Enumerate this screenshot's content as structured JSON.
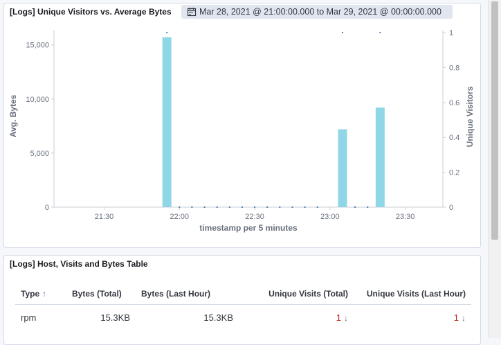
{
  "chart_panel": {
    "title": "[Logs] Unique Visitors vs. Average Bytes",
    "date_range": "Mar 28, 2021 @ 21:00:00.000 to Mar 29, 2021 @ 00:00:00.000",
    "icon": "calendar-icon"
  },
  "chart_data": {
    "type": "bar",
    "xlabel": "timestamp per 5 minutes",
    "ylabel_left": "Avg. Bytes",
    "ylabel_right": "Unique Visitors",
    "x_ticks": [
      "21:30",
      "22:00",
      "22:30",
      "23:00",
      "23:30"
    ],
    "y_left_ticks": [
      "0",
      "5,000",
      "10,000",
      "15,000"
    ],
    "y_right_ticks": [
      "0",
      "0.2",
      "0.4",
      "0.6",
      "0.8",
      "1"
    ],
    "ylim_left": [
      0,
      16200
    ],
    "ylim_right": [
      0,
      1
    ],
    "bars_color": "#8fd7e6",
    "bars": [
      {
        "x": "21:55",
        "value": 15700
      },
      {
        "x": "23:05",
        "value": 7200
      },
      {
        "x": "23:20",
        "value": 9200
      }
    ],
    "visitor_points": [
      {
        "x": "21:55",
        "value": 1
      },
      {
        "x": "22:00",
        "value": 0
      },
      {
        "x": "22:05",
        "value": 0
      },
      {
        "x": "22:10",
        "value": 0
      },
      {
        "x": "22:15",
        "value": 0
      },
      {
        "x": "22:20",
        "value": 0
      },
      {
        "x": "22:25",
        "value": 0
      },
      {
        "x": "22:30",
        "value": 0
      },
      {
        "x": "22:35",
        "value": 0
      },
      {
        "x": "22:40",
        "value": 0
      },
      {
        "x": "22:45",
        "value": 0
      },
      {
        "x": "22:50",
        "value": 0
      },
      {
        "x": "22:55",
        "value": 0
      },
      {
        "x": "23:05",
        "value": 1
      },
      {
        "x": "23:10",
        "value": 0
      },
      {
        "x": "23:15",
        "value": 0
      },
      {
        "x": "23:20",
        "value": 1
      }
    ],
    "points_color": "#4e7eb4",
    "grid": false
  },
  "table_panel": {
    "title": "[Logs] Host, Visits and Bytes Table",
    "columns": [
      "Type",
      "Bytes (Total)",
      "Bytes (Last Hour)",
      "Unique Visits (Total)",
      "Unique Visits (Last Hour)"
    ],
    "rows": [
      {
        "type": "rpm",
        "bytes_total": "15.3KB",
        "bytes_last_hour": "15.3KB",
        "visits_total": "1",
        "visits_last_hour": "1"
      }
    ]
  }
}
